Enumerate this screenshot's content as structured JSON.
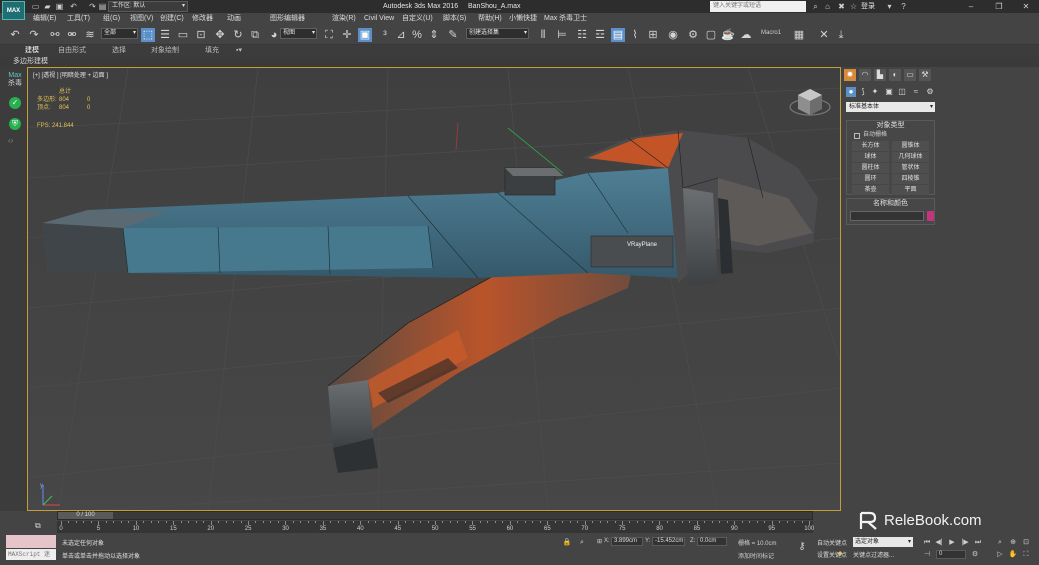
{
  "title_bar": {
    "logo": "MAX",
    "workspace": "工作区: 默认",
    "app_title": "Autodesk 3ds Max 2016",
    "file_name": "BanShou_A.max",
    "search_placeholder": "键入关键字或短语",
    "login": "登录"
  },
  "menu": [
    "编辑(E)",
    "工具(T)",
    "组(G)",
    "视图(V)",
    "创建(C)",
    "修改器",
    "动画",
    "图形编辑器",
    "渲染(R)",
    "Civil View",
    "自定义(U)",
    "脚本(S)",
    "帮助(H)",
    "小懒快捷",
    "Max 杀毒卫士"
  ],
  "toolbar": {
    "filter": "全部",
    "reference_coord": "视图",
    "named_selection": "创建选择集",
    "macro": "Macro1"
  },
  "ribbon": {
    "tabs": [
      "建模",
      "自由形式",
      "选择",
      "对象绘制",
      "填充"
    ],
    "active_tab": "建模",
    "sub_label": "多边形建模"
  },
  "left_strip": {
    "label_top": "Max",
    "label_bottom": "杀毒"
  },
  "viewport": {
    "label": "[+] [透视 ] [明暗处理 + 边面 ]",
    "stats_header": "总计",
    "stats": [
      {
        "key": "多边形:",
        "total": "804",
        "sel": "0"
      },
      {
        "key": "顶点:",
        "total": "804",
        "sel": "0"
      }
    ],
    "fps": "FPS:   241.844",
    "object_label": "VRayPlane",
    "axis_label": "y"
  },
  "command_panel": {
    "category": "标准基本体",
    "object_type_title": "对象类型",
    "autogrid": "自动栅格",
    "objects": [
      "长方体",
      "圆锥体",
      "球体",
      "几何球体",
      "圆柱体",
      "管状体",
      "圆环",
      "四棱锥",
      "茶壶",
      "平面"
    ],
    "name_color_title": "名称和颜色",
    "swatch_color": "#c2347c"
  },
  "timeline": {
    "slider_label": "0 / 100",
    "ticks": [
      "0",
      "5",
      "10",
      "15",
      "20",
      "25",
      "30",
      "35",
      "40",
      "45",
      "50",
      "55",
      "60",
      "65",
      "70",
      "75",
      "80",
      "85",
      "90",
      "95",
      "100"
    ]
  },
  "status": {
    "selection": "未选定任何对象",
    "prompt": "单击或单击并拖动以选择对象",
    "x": "3.899cm",
    "y": "-15.452cm",
    "z": "0.0cm",
    "grid": "栅格 = 10.0cm",
    "add_time_tag": "添加时间标记",
    "auto_key": "自动关键点",
    "set_key": "设置关键点",
    "selected_object": "选定对象",
    "key_filters": "关键点过滤器...",
    "frame": "0",
    "maxscript": "MAXScript 迷"
  },
  "watermark": "ReleBook.com"
}
